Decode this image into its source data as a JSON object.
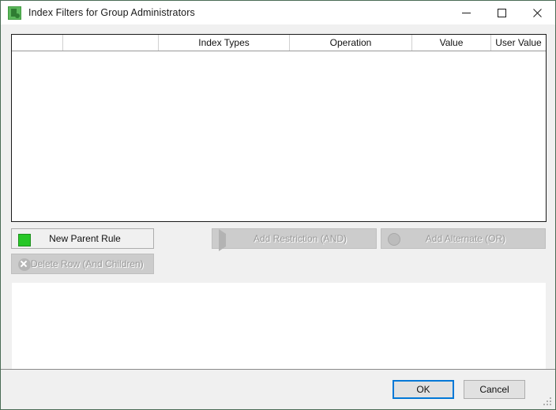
{
  "window": {
    "title": "Index Filters for Group Administrators",
    "icon": "filter-lock-icon",
    "controls": {
      "minimize": "—",
      "maximize": "□",
      "close": "✕"
    }
  },
  "grid": {
    "columns": [
      {
        "label": "",
        "width": 65
      },
      {
        "label": "",
        "width": 121
      },
      {
        "label": "Index Types",
        "width": 166
      },
      {
        "label": "Operation",
        "width": 155
      },
      {
        "label": "Value",
        "width": 100
      },
      {
        "label": "User Value",
        "width": 69
      }
    ],
    "rows": []
  },
  "actions": [
    {
      "id": "new-parent-rule",
      "label": "New Parent Rule",
      "icon": "green-square-icon",
      "enabled": true
    },
    {
      "id": "add-restriction-and",
      "label": "Add Restriction (AND)",
      "icon": "play-triangle-icon",
      "enabled": false
    },
    {
      "id": "add-alternate-or",
      "label": "Add Alternate (OR)",
      "icon": "circle-icon",
      "enabled": false
    },
    {
      "id": "delete-row-and-children",
      "label": "Delete Row (And Children)",
      "icon": "circle-x-icon",
      "enabled": false
    }
  ],
  "preview": {
    "text": ""
  },
  "footer": {
    "ok_label": "OK",
    "cancel_label": "Cancel"
  },
  "colors": {
    "accent": "#0078d7",
    "brand_green": "#5cb85c",
    "dialog_bg": "#f0f0f0",
    "disabled_bg": "#cccccc"
  }
}
